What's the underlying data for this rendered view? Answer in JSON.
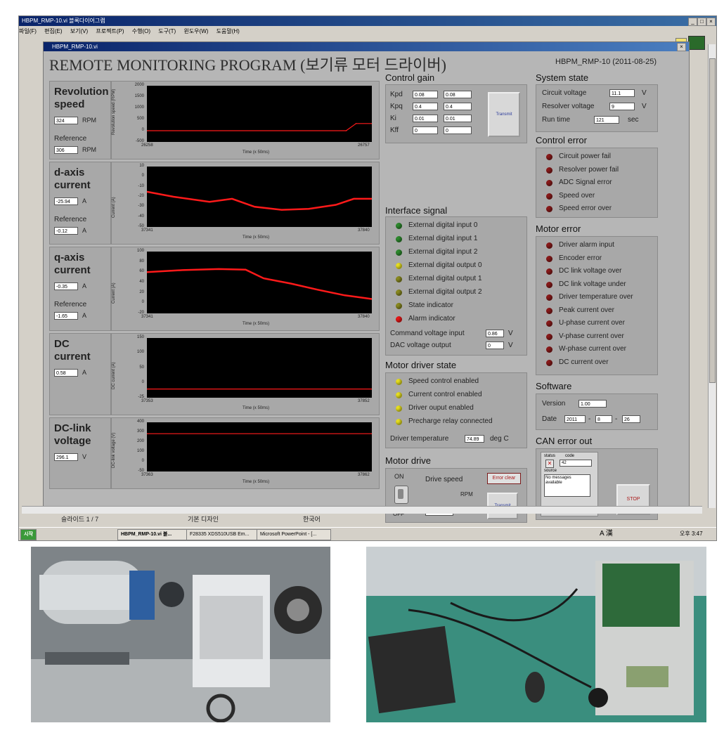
{
  "window": {
    "title": "HBPM_RMP-10.vi 블록다이어그램",
    "menu": [
      "파일(F)",
      "편집(E)",
      "보기(V)",
      "프로젝트(P)",
      "수행(O)",
      "도구(T)",
      "윈도우(W)",
      "도움말(H)"
    ],
    "inner_title": "HBPM_RMP-10.vi"
  },
  "panel": {
    "title": "REMOTE MONITORING PROGRAM (보기류 모터 드라이버)",
    "version_tag": "HBPM_RMP-10 (2011-08-25)"
  },
  "left_blocks": [
    {
      "label_1": "Revolution",
      "label_2": "speed",
      "value": "324",
      "unit": "RPM",
      "ref_label": "Reference",
      "ref_value": "306",
      "ref_unit": "RPM"
    },
    {
      "label_1": "d-axis",
      "label_2": "current",
      "value": "-25.94",
      "unit": "A",
      "ref_label": "Reference",
      "ref_value": "-0.12",
      "ref_unit": "A"
    },
    {
      "label_1": "q-axis",
      "label_2": "current",
      "value": "-0.35",
      "unit": "A",
      "ref_label": "Reference",
      "ref_value": "-1.65",
      "ref_unit": "A"
    },
    {
      "label_1": "DC",
      "label_2": "current",
      "value": "0.58",
      "unit": "A"
    },
    {
      "label_1": "DC-link",
      "label_2": "voltage",
      "value": "296.1",
      "unit": "V"
    }
  ],
  "chart_data": [
    {
      "type": "line",
      "ylabel": "Revolution speed (RPM)",
      "xlabel": "Time (x 50ms)",
      "yticks": [
        "2000",
        "1500",
        "1000",
        "500",
        "0",
        "-500"
      ],
      "xticks": [
        "26258",
        "26757"
      ],
      "ylim": [
        -500,
        2000
      ],
      "x": [
        26258,
        26700,
        26722,
        26757
      ],
      "values": [
        0,
        0,
        320,
        320
      ],
      "color": "#ff1a1a"
    },
    {
      "type": "line",
      "ylabel": "Current (A)",
      "xlabel": "Time (x 50ms)",
      "yticks": [
        "10",
        "0",
        "-10",
        "-20",
        "-30",
        "-40",
        "-50"
      ],
      "xticks": [
        "37341",
        "37840"
      ],
      "ylim": [
        -50,
        10
      ],
      "x": [
        37341,
        37400,
        37480,
        37530,
        37580,
        37640,
        37700,
        37760,
        37800,
        37840
      ],
      "values": [
        -15,
        -20,
        -25,
        -22,
        -30,
        -33,
        -32,
        -28,
        -22,
        -22
      ],
      "color": "#ff1a1a"
    },
    {
      "type": "line",
      "ylabel": "Current (A)",
      "xlabel": "Time (x 50ms)",
      "yticks": [
        "100",
        "80",
        "60",
        "40",
        "20",
        "0",
        "-20"
      ],
      "xticks": [
        "37341",
        "37840"
      ],
      "ylim": [
        -20,
        100
      ],
      "x": [
        37341,
        37420,
        37500,
        37560,
        37600,
        37660,
        37720,
        37780,
        37840
      ],
      "values": [
        60,
        64,
        66,
        65,
        48,
        38,
        26,
        15,
        8
      ],
      "color": "#ff1a1a"
    },
    {
      "type": "line",
      "ylabel": "DC current (A)",
      "xlabel": "Time (x 50ms)",
      "yticks": [
        "150",
        "100",
        "50",
        "0",
        "-25"
      ],
      "xticks": [
        "37353",
        "37852"
      ],
      "ylim": [
        -25,
        150
      ],
      "x": [
        37353,
        37852
      ],
      "values": [
        0.5,
        0.5
      ],
      "color": "#ff1a1a"
    },
    {
      "type": "line",
      "ylabel": "DC-link voltage (V)",
      "xlabel": "Time (x 50ms)",
      "yticks": [
        "400",
        "300",
        "200",
        "100",
        "0",
        "-50"
      ],
      "xticks": [
        "37363",
        "37862"
      ],
      "ylim": [
        -50,
        400
      ],
      "x": [
        37363,
        37862
      ],
      "values": [
        296,
        296
      ],
      "color": "#ff1a1a"
    }
  ],
  "control_gain": {
    "title": "Control gain",
    "rows": [
      {
        "label": "Kpd",
        "v1": "0.08",
        "v2": "0.08"
      },
      {
        "label": "Kpq",
        "v1": "0.4",
        "v2": "0.4"
      },
      {
        "label": "Ki",
        "v1": "0.01",
        "v2": "0.01"
      },
      {
        "label": "Kff",
        "v1": "0",
        "v2": "0"
      }
    ],
    "transmit": "Transmit"
  },
  "interface_signal": {
    "title": "Interface signal",
    "items": [
      {
        "label": "External digital input 0",
        "color": "#2e8b2e"
      },
      {
        "label": "External digital input 1",
        "color": "#2e8b2e"
      },
      {
        "label": "External digital input 2",
        "color": "#2e8b2e"
      },
      {
        "label": "External digital output 0",
        "color": "#e8e020"
      },
      {
        "label": "External digital output 1",
        "color": "#8a8a20"
      },
      {
        "label": "External digital output 2",
        "color": "#8a8a20"
      },
      {
        "label": "State indicator",
        "color": "#8a8a20"
      },
      {
        "label": "Alarm indicator",
        "color": "#e81818"
      }
    ],
    "cmd_label": "Command voltage input",
    "cmd_value": "0.86",
    "cmd_unit": "V",
    "dac_label": "DAC voltage output",
    "dac_value": "0",
    "dac_unit": "V"
  },
  "motor_driver_state": {
    "title": "Motor driver state",
    "items": [
      {
        "label": "Speed control enabled",
        "color": "#e8e020"
      },
      {
        "label": "Current control enabled",
        "color": "#e8e020"
      },
      {
        "label": "Driver ouput enabled",
        "color": "#e8e020"
      },
      {
        "label": "Precharge relay connected",
        "color": "#e8e020"
      }
    ],
    "temp_label": "Driver temperature",
    "temp_value": "74.89",
    "temp_unit": "deg C"
  },
  "motor_drive": {
    "title": "Motor drive",
    "on": "ON",
    "off": "OFF",
    "speed_label": "Drive speed",
    "rpm_top": "RPM",
    "rpm_value": "0",
    "rpm_bottom": "RPM",
    "error_clear": "Error clear",
    "transmit": "Transmit"
  },
  "system_state": {
    "title": "System state",
    "rows": [
      {
        "label": "Circuit voltage",
        "value": "11.1",
        "unit": "V"
      },
      {
        "label": "Resolver voltage",
        "value": "9",
        "unit": "V"
      },
      {
        "label": "Run time",
        "value": "121",
        "unit": "sec"
      }
    ]
  },
  "control_error": {
    "title": "Control error",
    "items": [
      "Circuit power fail",
      "Resolver power fail",
      "ADC Signal error",
      "Speed over",
      "Speed error over"
    ]
  },
  "motor_error": {
    "title": "Motor error",
    "items": [
      "Driver alarm input",
      "Encoder error",
      "DC link voltage over",
      "DC link voltage under",
      "Driver temperature over",
      "Peak current over",
      "U-phase current over",
      "V-phase current over",
      "W-phase current over",
      "DC current over"
    ]
  },
  "software": {
    "title": "Software",
    "version_label": "Version",
    "version_value": "1.00",
    "date_label": "Date",
    "year": "2011",
    "month": "8",
    "day": "26",
    "sep": "-"
  },
  "can_error": {
    "title": "CAN error out",
    "status_label": "status",
    "code_label": "code",
    "code_value": "42",
    "source_label": "source",
    "message": "No messages available",
    "stop": "STOP"
  },
  "statusbar": {
    "slide": "슬라이드 1 / 7",
    "design": "기본 디자인",
    "lang": "한국어"
  },
  "taskbar": {
    "start": "시작",
    "tasks": [
      "HBPM_RMP-10.vi 블...",
      "F28335 XDS510USB Em...",
      "Microsoft PowerPoint - [..."
    ],
    "tray_text": "A 漢",
    "clock": "오후 3:47"
  }
}
